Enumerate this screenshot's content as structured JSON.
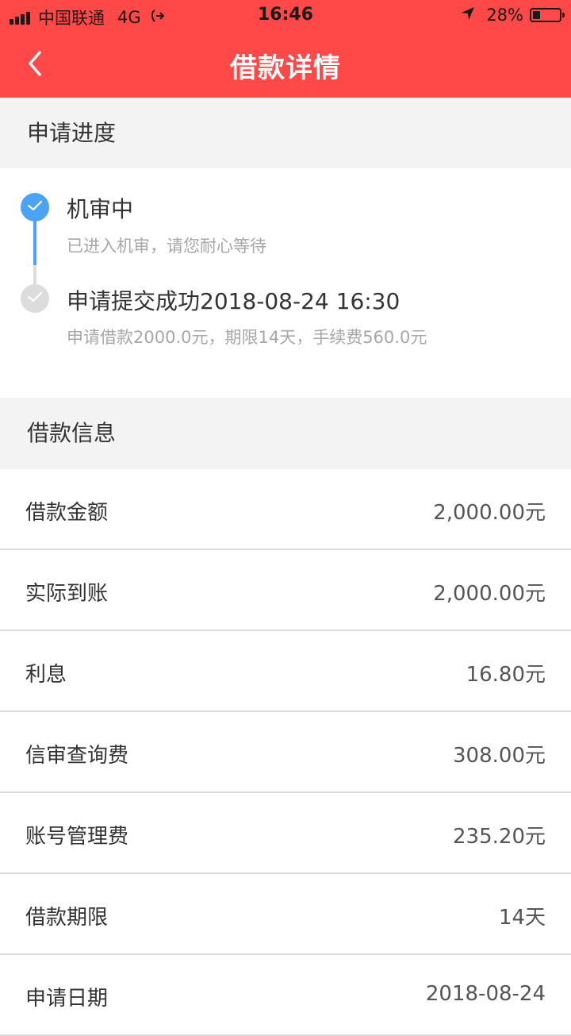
{
  "status_bar": {
    "carrier": "中国联通",
    "network": "4G",
    "time": "16:46",
    "battery": "28%",
    "battery_level": 0.28
  },
  "nav": {
    "title": "借款详情",
    "back_icon": "chevron-left-icon"
  },
  "progress": {
    "section_title": "申请进度",
    "steps": [
      {
        "title": "机审中",
        "subtitle": "已进入机审，请您耐心等待",
        "state": "active",
        "icon": "check-icon"
      },
      {
        "title": "申请提交成功2018-08-24 16:30",
        "subtitle": "申请借款2000.0元，期限14天，手续费560.0元",
        "state": "done",
        "icon": "check-icon"
      }
    ]
  },
  "loan_info": {
    "section_title": "借款信息",
    "rows": [
      {
        "label": "借款金额",
        "value": "2,000.00元"
      },
      {
        "label": "实际到账",
        "value": "2,000.00元"
      },
      {
        "label": "利息",
        "value": "16.80元"
      },
      {
        "label": "信审查询费",
        "value": "308.00元"
      },
      {
        "label": "账号管理费",
        "value": "235.20元"
      },
      {
        "label": "借款期限",
        "value": "14天"
      },
      {
        "label": "申请日期",
        "value": "2018-08-24"
      }
    ]
  },
  "colors": {
    "header": "#ff4848",
    "timeline_active": "#4aa3f3",
    "timeline_inactive": "#dcdcdc",
    "section_bg": "#f3f3f3"
  }
}
